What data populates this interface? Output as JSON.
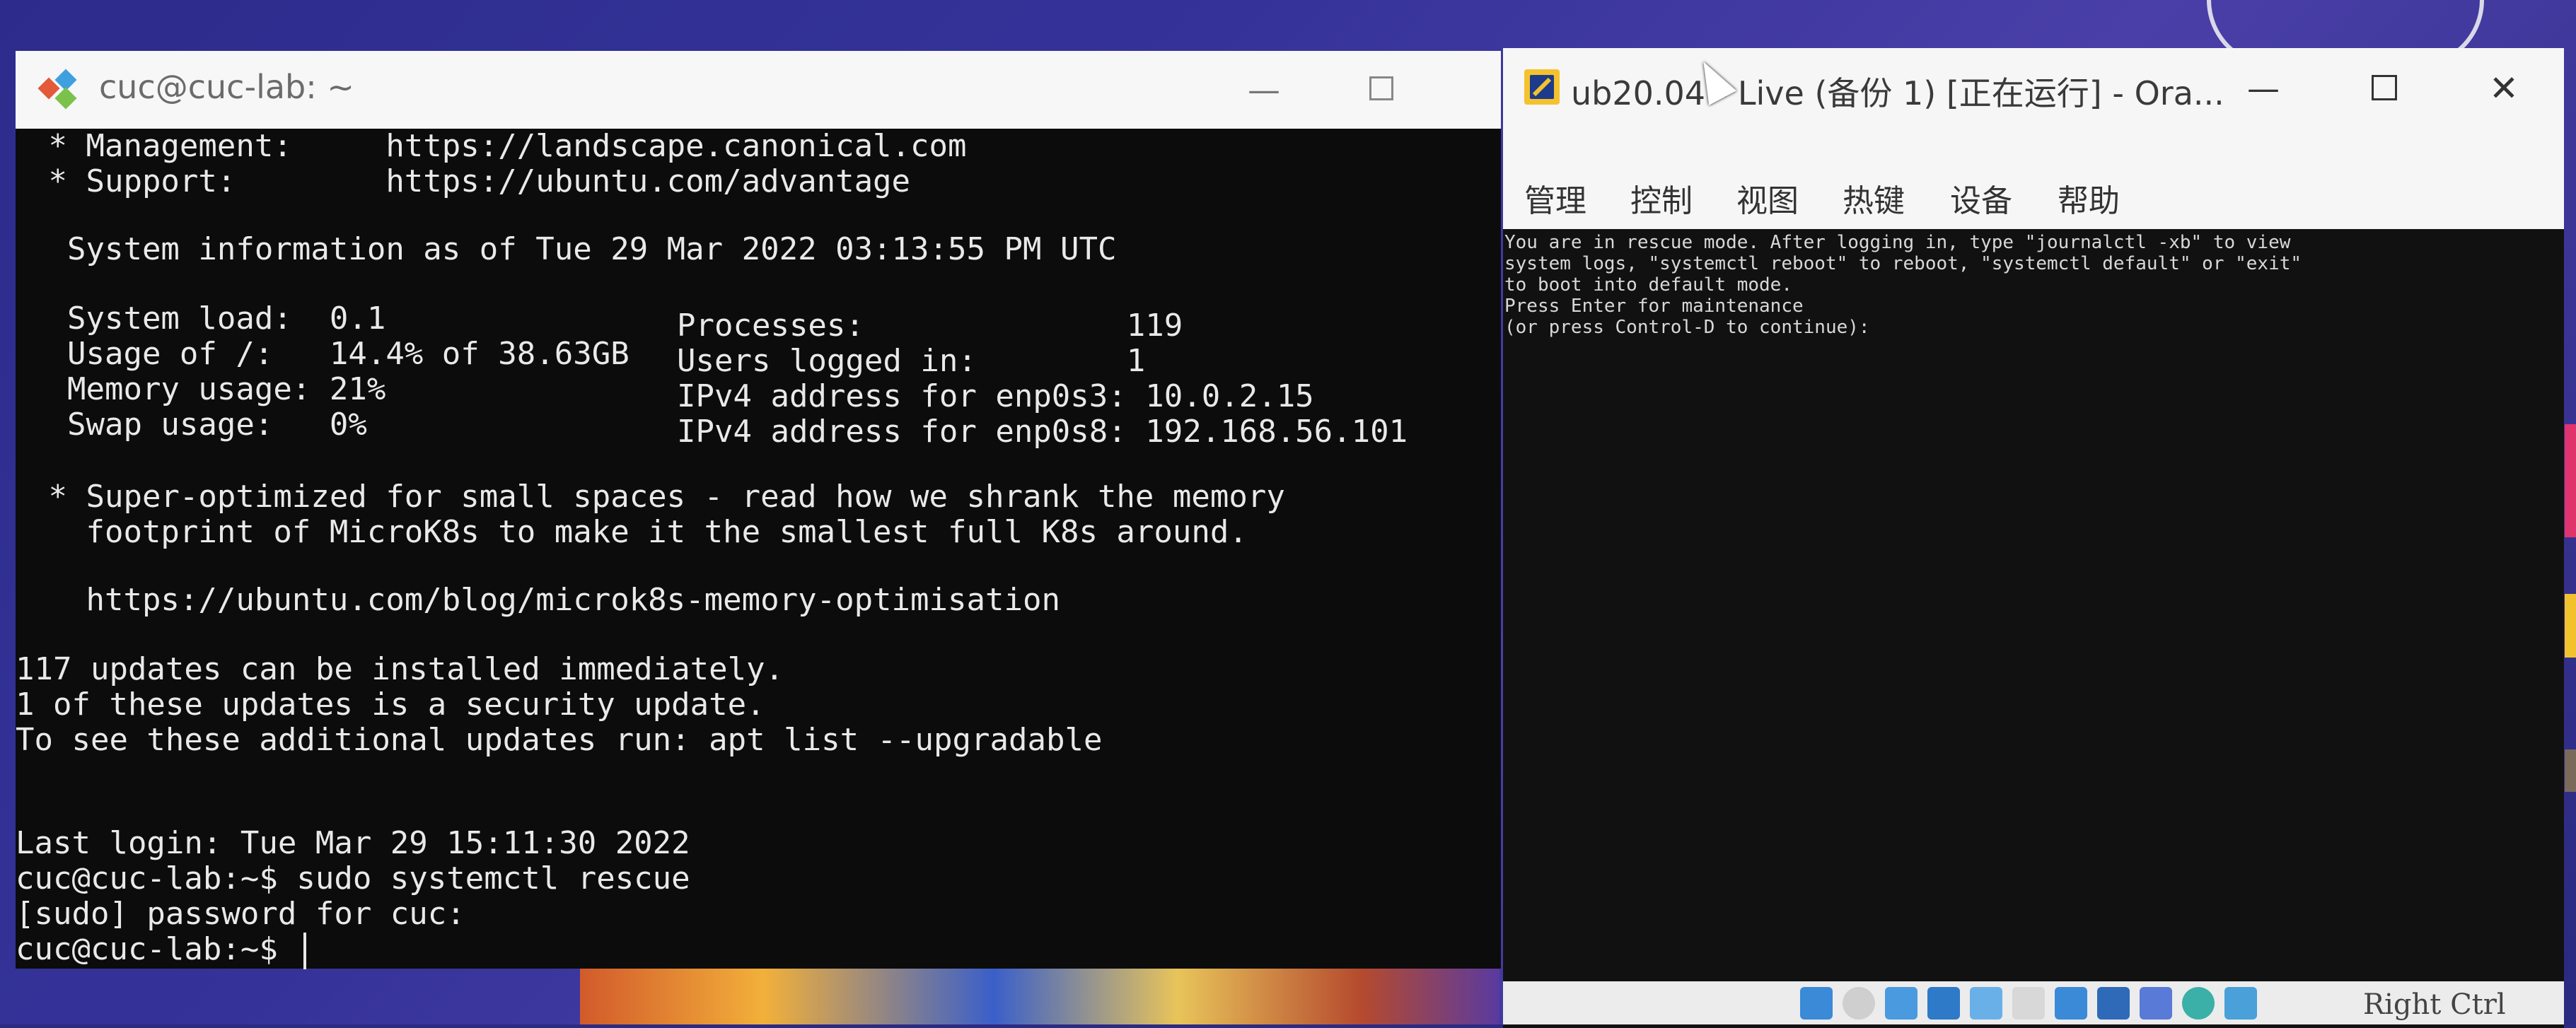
{
  "terminal": {
    "title": "cuc@cuc-lab: ~",
    "lines": [
      " * Management:     https://landscape.canonical.com",
      " * Support:        https://ubuntu.com/advantage",
      "",
      "  System information as of Tue 29 Mar 2022 03:13:55 PM UTC",
      "",
      "  System load:  0.1",
      "  Usage of /:   14.4% of 38.63GB",
      "  Memory usage: 21%",
      "  Swap usage:   0%",
      "",
      " * Super-optimized for small spaces - read how we shrank the memory",
      "   footprint of MicroK8s to make it the smallest full K8s around.",
      "",
      "   https://ubuntu.com/blog/microk8s-memory-optimisation",
      "",
      "117 updates can be installed immediately.",
      "1 of these updates is a security update.",
      "To see these additional updates run: apt list --upgradable",
      "",
      "",
      "Last login: Tue Mar 29 15:11:30 2022",
      "cuc@cuc-lab:~$ sudo systemctl rescue",
      "[sudo] password for cuc:",
      "cuc@cuc-lab:~$ "
    ],
    "right_column": [
      "Processes:              119",
      "Users logged in:        1",
      "IPv4 address for enp0s3: 10.0.2.15",
      "IPv4 address for enp0s8: 192.168.56.101"
    ]
  },
  "virtualbox": {
    "title": "ub20.04 - Live (备份 1) [正在运行] - Ora...",
    "menu": [
      "管理",
      "控制",
      "视图",
      "热键",
      "设备",
      "帮助"
    ],
    "console_lines": [
      "You are in rescue mode. After logging in, type \"journalctl -xb\" to view",
      "system logs, \"systemctl reboot\" to reboot, \"systemctl default\" or \"exit\"",
      "to boot into default mode.",
      "Press Enter for maintenance",
      "(or press Control-D to continue):"
    ],
    "host_key": "Right Ctrl"
  },
  "colors": {
    "terminal_bg": "#0c0c0c",
    "terminal_fg": "#e9e9e9",
    "titlebar": "#f6f6f6",
    "desktop": "#2c2a82"
  }
}
